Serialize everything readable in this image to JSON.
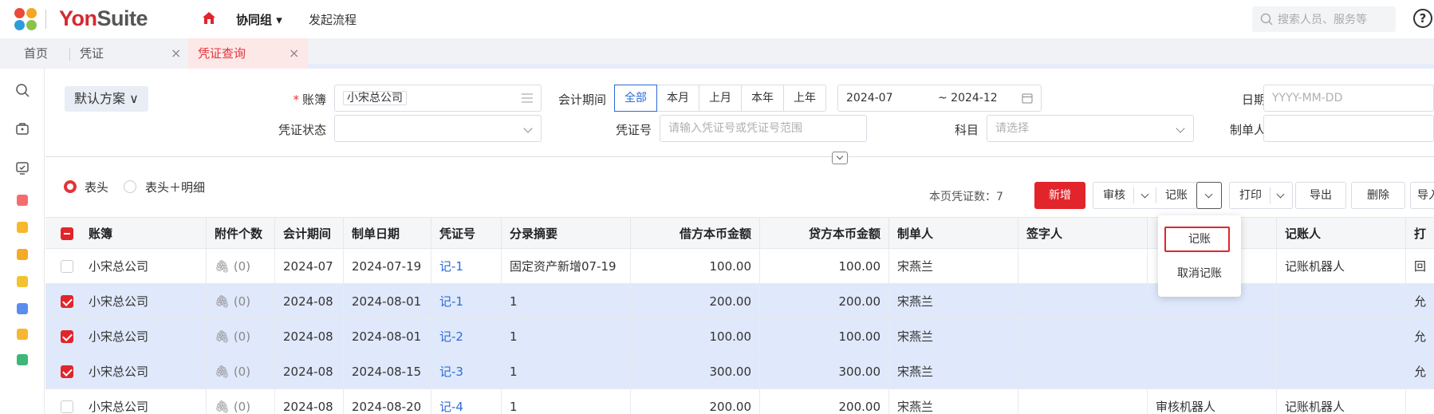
{
  "app": {
    "brand_a": "Yon",
    "brand_b": "Suite",
    "nav_group": "协同组 ▾",
    "nav_flow": "发起流程",
    "search_placeholder": "搜索人员、服务等",
    "help": "?",
    "colors": {
      "brand_red": "#d7282f",
      "link_blue": "#2d6bd6",
      "selected_row": "#dfe9fb"
    }
  },
  "tabs": {
    "home": "首页",
    "voucher": "凭证",
    "voucher_close": "×",
    "query": "凭证查询",
    "query_close": "×"
  },
  "filters": {
    "scheme": "默认方案 ∨",
    "ledger_label": "账簿",
    "ledger_required": "*",
    "ledger_value": "小宋总公司",
    "period_label": "会计期间",
    "period_buttons": [
      "全部",
      "本月",
      "上月",
      "本年",
      "上年"
    ],
    "period_from": "2024-07",
    "period_to": "~ 2024-12",
    "date_label": "日期",
    "date_placeholder": "YYYY-MM-DD",
    "status_label": "凭证状态",
    "voucher_no_label": "凭证号",
    "voucher_no_placeholder": "请输入凭证号或凭证号范围",
    "subject_label": "科目",
    "subject_placeholder": "请选择",
    "maker_label": "制单人"
  },
  "toolbar": {
    "radio_head": "表头",
    "radio_head_detail": "表头＋明细",
    "page_count": "本页凭证数：7",
    "new": "新增",
    "audit": "审核",
    "post": "记账",
    "print": "打印",
    "export": "导出",
    "delete": "删除",
    "import": "导入"
  },
  "dropdown": {
    "items": [
      "记账",
      "取消记账"
    ]
  },
  "table": {
    "headers": [
      "账簿",
      "附件个数",
      "会计期间",
      "制单日期",
      "凭证号",
      "分录摘要",
      "借方本币金额",
      "贷方本币金额",
      "制单人",
      "签字人",
      "",
      "记账人",
      "打"
    ],
    "rows": [
      {
        "ledger": "小宋总公司",
        "attach": "(0)",
        "period": "2024-07",
        "date": "2024-07-19",
        "no": "记-1",
        "summary": "固定资产新增07-19",
        "debit": "100.00",
        "credit": "100.00",
        "maker": "宋燕兰",
        "signer": "",
        "auditor": "",
        "poster": "记账机器人",
        "extra": "回"
      },
      {
        "ledger": "小宋总公司",
        "attach": "(0)",
        "period": "2024-08",
        "date": "2024-08-01",
        "no": "记-1",
        "summary": "1",
        "debit": "200.00",
        "credit": "200.00",
        "maker": "宋燕兰",
        "signer": "",
        "auditor": "",
        "poster": "",
        "extra": "允"
      },
      {
        "ledger": "小宋总公司",
        "attach": "(0)",
        "period": "2024-08",
        "date": "2024-08-01",
        "no": "记-2",
        "summary": "1",
        "debit": "100.00",
        "credit": "100.00",
        "maker": "宋燕兰",
        "signer": "",
        "auditor": "",
        "poster": "",
        "extra": "允"
      },
      {
        "ledger": "小宋总公司",
        "attach": "(0)",
        "period": "2024-08",
        "date": "2024-08-15",
        "no": "记-3",
        "summary": "1",
        "debit": "300.00",
        "credit": "300.00",
        "maker": "宋燕兰",
        "signer": "",
        "auditor": "",
        "poster": "",
        "extra": "允"
      },
      {
        "ledger": "小宋总公司",
        "attach": "(0)",
        "period": "2024-08",
        "date": "2024-08-20",
        "no": "记-4",
        "summary": "1",
        "debit": "200.00",
        "credit": "200.00",
        "maker": "宋燕兰",
        "signer": "",
        "auditor": "审核机器人",
        "poster": "记账机器人",
        "extra": ""
      }
    ]
  }
}
